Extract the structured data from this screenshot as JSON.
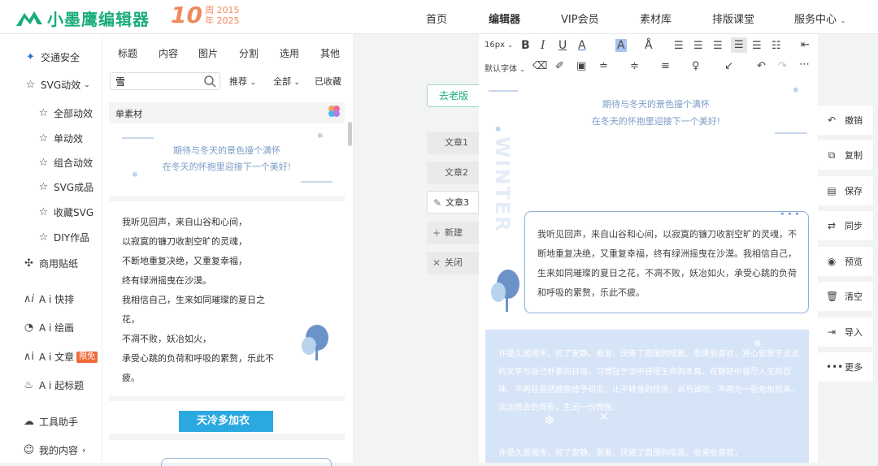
{
  "header": {
    "logo_text": "小墨鹰编辑器",
    "anniv_big": "10",
    "anniv_line1": "周 2015",
    "anniv_line2": "年 2025",
    "nav": [
      "首页",
      "编辑器",
      "VIP会员",
      "素材库",
      "排版课堂",
      "服务中心"
    ]
  },
  "sidebar": {
    "items": [
      {
        "label": "交通安全",
        "icon": "sparkle-icon"
      },
      {
        "label": "SVG动效",
        "icon": "star-icon"
      },
      {
        "label": "全部动效",
        "icon": "star-icon"
      },
      {
        "label": "单动效",
        "icon": "star-icon"
      },
      {
        "label": "组合动效",
        "icon": "star-icon"
      },
      {
        "label": "SVG成品",
        "icon": "star-icon"
      },
      {
        "label": "收藏SVG",
        "icon": "star-icon"
      },
      {
        "label": "DIY作品",
        "icon": "star-icon"
      },
      {
        "label": "商用贴纸",
        "icon": "puzzle-icon"
      },
      {
        "label": "A i 快排",
        "icon": "ai-icon"
      },
      {
        "label": "A i 绘画",
        "icon": "palette-icon"
      },
      {
        "label": "A i 文章",
        "icon": "ai-article-icon"
      },
      {
        "label": "A i 起标题",
        "icon": "flame-icon"
      },
      {
        "label": "工具助手",
        "icon": "cloud-icon"
      },
      {
        "label": "我的内容",
        "icon": "user-icon"
      }
    ],
    "limited_badge": "限免"
  },
  "library": {
    "tabs": [
      "标题",
      "内容",
      "图片",
      "分割",
      "选用",
      "其他"
    ],
    "search_value": "雪",
    "filters": [
      "推荐",
      "全部",
      "已收藏"
    ],
    "section_title": "单素材",
    "card1_line1": "期待与冬天的景色撞个满怀",
    "card1_line2": "在冬天的怀抱里迎接下一个美好!",
    "card2_lines": [
      "我听见回声，来自山谷和心间，",
      "以寂寞的镰刀收割空旷的灵魂，",
      "不断地重复决绝，又重复幸福，",
      "终有绿洲摇曳在沙漠。",
      "我相信自己，生来如同璀璨的夏日之",
      "花，",
      "不凋不败，妖冶如火，",
      "承受心跳的负荷和呼吸的累赘，乐此不",
      "疲。"
    ],
    "card3_label": "天冷多加衣"
  },
  "workspace": {
    "old_version": "去老版",
    "articles": [
      "文章1",
      "文章2",
      "文章3"
    ],
    "new_label": "新建",
    "close_label": "关闭"
  },
  "toolbar": {
    "font_size": "16px",
    "font_family": "默认字体"
  },
  "doc": {
    "line1": "期待与冬天的景色撞个满怀",
    "line2": "在冬天的怀抱里迎接下一个美好!",
    "winter": "WINTER",
    "para": "我听见回声，来自山谷和心间，以寂寞的镰刀收割空旷的灵魂，不断地重复决绝，又重复幸福，终有绿洲摇曳在沙漠。我相信自己，生来如同璀璨的夏日之花，不凋不败，妖冶如火，承受心跳的负荷和呼吸的累赘，乐此不疲。",
    "blue_para": "许是久居闹市，扰了安静。渐渐，厌倦了周围的喧嚣。愈来愈喜欢，将心安放于淡淡的文字与自己朴素的日常。习惯在宁淡中感悟生命的本真，在静好中尝尽人生的百味。不再轻易把那些给予初见，止于转身的优伤，诉与谁听。不再为一些匆匆而来，淡淡而去的背影，生出一份惆怅。",
    "blue_para2": "许是久居闹市，扰了安静。渐渐，厌倦了周围的喧嚣。愈来愈喜欢，"
  },
  "rightbar": {
    "items": [
      {
        "label": "撤销",
        "icon": "undo-icon"
      },
      {
        "label": "复制",
        "icon": "copy-icon"
      },
      {
        "label": "保存",
        "icon": "save-icon"
      },
      {
        "label": "同步",
        "icon": "sync-icon"
      },
      {
        "label": "预览",
        "icon": "eye-icon"
      },
      {
        "label": "清空",
        "icon": "trash-icon"
      },
      {
        "label": "导入",
        "icon": "import-icon"
      },
      {
        "label": "更多",
        "icon": "more-icon"
      }
    ]
  },
  "colors": {
    "brand": "#1aad7a",
    "anniversary": "#f08a5d",
    "doc_blue": "#7a9cc6",
    "blue_block": "#d6e4f7"
  }
}
